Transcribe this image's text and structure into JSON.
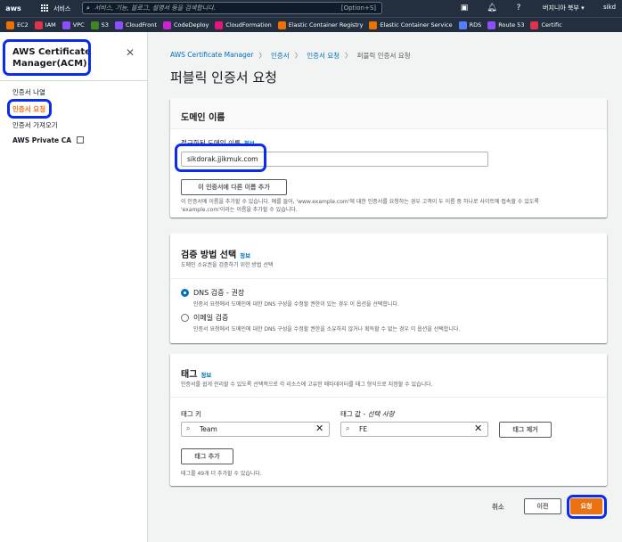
{
  "topbar": {
    "logo": "aws",
    "services_label": "서비스",
    "search_placeholder": "서비스, 기능, 블로그, 설명서 등을 검색합니다.",
    "search_shortcut": "[Option+S]",
    "region": "버지니아 북부 ▾",
    "account": "sikd"
  },
  "favorites": [
    {
      "label": "EC2",
      "color": "#ed7100"
    },
    {
      "label": "IAM",
      "color": "#dd344c"
    },
    {
      "label": "VPC",
      "color": "#8c4fff"
    },
    {
      "label": "S3",
      "color": "#3f8624"
    },
    {
      "label": "CloudFront",
      "color": "#8c4fff"
    },
    {
      "label": "CodeDeploy",
      "color": "#c925d1"
    },
    {
      "label": "CloudFormation",
      "color": "#e7157b"
    },
    {
      "label": "Elastic Container Registry",
      "color": "#ed7100"
    },
    {
      "label": "Elastic Container Service",
      "color": "#ed7100"
    },
    {
      "label": "RDS",
      "color": "#527fff"
    },
    {
      "label": "Route 53",
      "color": "#8c4fff"
    },
    {
      "label": "Certific",
      "color": "#dd344c"
    }
  ],
  "sidebar": {
    "title_line1": "AWS Certificate",
    "title_line2": "Manager(ACM)",
    "items": [
      {
        "label": "인증서 나열"
      },
      {
        "label": "인증서 요청"
      },
      {
        "label": "인증서 가져오기"
      },
      {
        "label": "AWS Private CA"
      }
    ]
  },
  "breadcrumb": {
    "root": "AWS Certificate Manager",
    "level2": "인증서",
    "level3": "인증서 요청",
    "current": "퍼블릭 인증서 요청"
  },
  "page_title": "퍼블릭 인증서 요청",
  "domain_panel": {
    "title": "도메인 이름",
    "field_label": "정규화된 도메인 이름",
    "info": "정보",
    "domain_value": "sikdorak.jjikmuk.com",
    "add_name_button": "이 인증서에 다른 이름 추가",
    "help_line1": "이 인증서에 이름을 추가할 수 있습니다. 예를 들어, 'www.example.com'에 대한 인증서를 요청하는 경우 고객이 두 이름 중 하나로 사이트에 접속할 수 있도록",
    "help_line2": "'example.com'이라는 이름을 추가할 수 있습니다."
  },
  "validation_panel": {
    "title": "검증 방법 선택",
    "info": "정보",
    "desc": "도메인 소유권을 검증하기 위한 방법 선택",
    "dns_label": "DNS 검증 - 권장",
    "dns_desc": "인증서 요청에서 도메인에 대한 DNS 구성을 수정할 권한이 있는 경우 이 옵션을 선택합니다.",
    "email_label": "이메일 검증",
    "email_desc": "인증서 요청에서 도메인에 대한 DNS 구성을 수정할 권한을 소유하지 않거나 획득할 수 없는 경우 이 옵션을 선택합니다."
  },
  "tags_panel": {
    "title": "태그",
    "info": "정보",
    "desc": "인증서를 쉽게 관리할 수 있도록 선택적으로 각 리소스에 고유한 메타데이터를 태그 형식으로 지정할 수 있습니다.",
    "key_label": "태그 키",
    "value_label": "태그 값 - ",
    "value_optional": "선택 사항",
    "key_value": "Team",
    "value_value": "FE",
    "remove_button": "태그 제거",
    "add_button": "태그 추가",
    "remaining": "태그를 49개 더 추가할 수 있습니다."
  },
  "footer": {
    "cancel": "취소",
    "previous": "이전",
    "request": "요청"
  },
  "colors": {
    "highlight": "#0b2cf0",
    "primary": "#ec7211",
    "link": "#0073bb",
    "nav": "#232f3e"
  }
}
